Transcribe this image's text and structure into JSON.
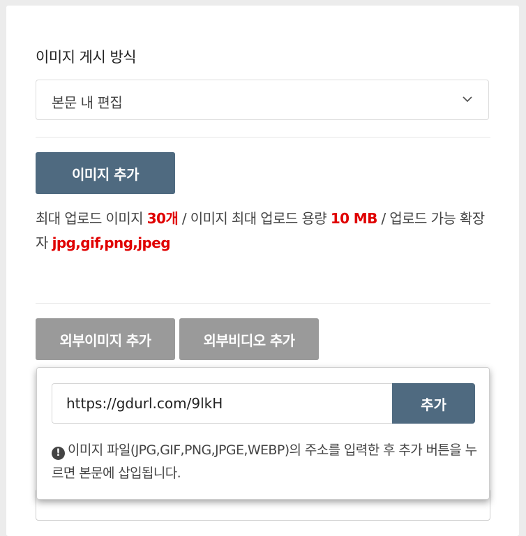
{
  "section": {
    "title": "이미지 게시 방식"
  },
  "display_mode": {
    "selected": "본문 내 편집",
    "icon": "chevron-down-icon"
  },
  "add_image_button": "이미지 추가",
  "upload_info": {
    "prefix": "최대 업로드 이미지 ",
    "max_count": "30개",
    "mid": " / 이미지 최대 업로드 용량 ",
    "max_size": "10 MB",
    "mid2": " / 업로드 가능 확장자 ",
    "extensions": "jpg,gif,png,jpeg",
    "highlight_color": "#e00000"
  },
  "tabs": [
    {
      "label": "외부이미지 추가"
    },
    {
      "label": "외부비디오 추가"
    }
  ],
  "external_image_popup": {
    "url_value": "https://gdurl.com/9lkH",
    "add_label": "추가",
    "help_icon": "exclamation-circle-icon",
    "help_text": "이미지 파일(JPG,GIF,PNG,JPGE,WEBP)의 주소를 입력한 후 추가 버튼을 누르면 본문에 삽입됩니다."
  },
  "colors": {
    "primary": "#4f6a80",
    "tab_gray": "#9a9a9a"
  }
}
